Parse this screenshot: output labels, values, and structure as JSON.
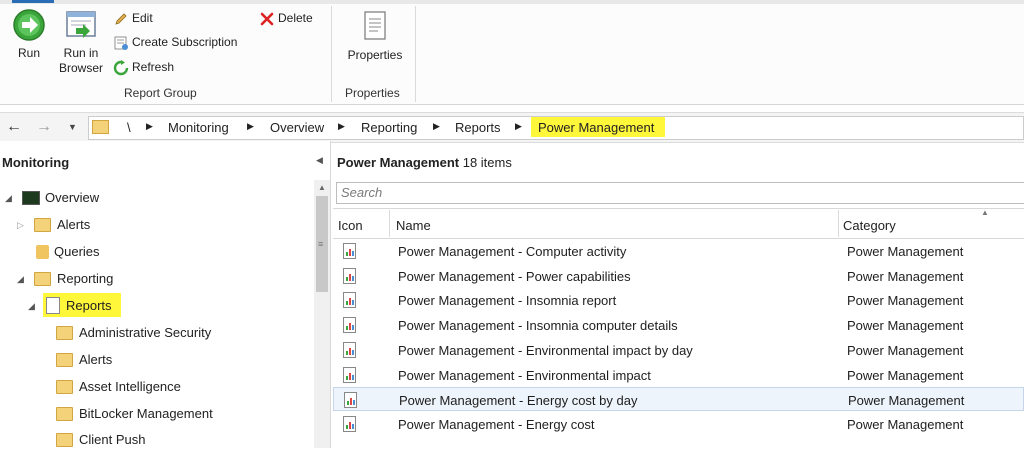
{
  "ribbon": {
    "run_label": "Run",
    "run_in_browser_label": "Run in\nBrowser",
    "edit_label": "Edit",
    "create_subscription_label": "Create Subscription",
    "refresh_label": "Refresh",
    "delete_label": "Delete",
    "report_group_label": "Report Group",
    "properties_button_label": "Properties",
    "properties_group_label": "Properties"
  },
  "address_bar": {
    "crumbs": [
      "\\",
      "Monitoring",
      "Overview",
      "Reporting",
      "Reports",
      "Power Management"
    ]
  },
  "left_pane": {
    "title": "Monitoring",
    "tree": [
      {
        "label": "Overview"
      },
      {
        "label": "Alerts"
      },
      {
        "label": "Queries"
      },
      {
        "label": "Reporting"
      },
      {
        "label": "Reports"
      },
      {
        "label": "Administrative Security"
      },
      {
        "label": "Alerts"
      },
      {
        "label": "Asset Intelligence"
      },
      {
        "label": "BitLocker Management"
      },
      {
        "label": "Client Push"
      }
    ]
  },
  "right_pane": {
    "title": "Power Management",
    "count": "18 items",
    "search_placeholder": "Search",
    "columns": {
      "icon": "Icon",
      "name": "Name",
      "category": "Category"
    },
    "rows": [
      {
        "name": "Power Management - Computer activity",
        "category": "Power Management"
      },
      {
        "name": "Power Management - Power capabilities",
        "category": "Power Management"
      },
      {
        "name": "Power Management - Insomnia report",
        "category": "Power Management"
      },
      {
        "name": "Power Management - Insomnia computer details",
        "category": "Power Management"
      },
      {
        "name": "Power Management - Environmental impact by day",
        "category": "Power Management"
      },
      {
        "name": "Power Management - Environmental impact",
        "category": "Power Management"
      },
      {
        "name": "Power Management - Energy cost by day",
        "category": "Power Management"
      },
      {
        "name": "Power Management - Energy cost",
        "category": "Power Management"
      }
    ]
  },
  "colors": {
    "highlight": "#fff73a",
    "selected_row": "#eef4fb",
    "folder": "#f3d27a"
  }
}
